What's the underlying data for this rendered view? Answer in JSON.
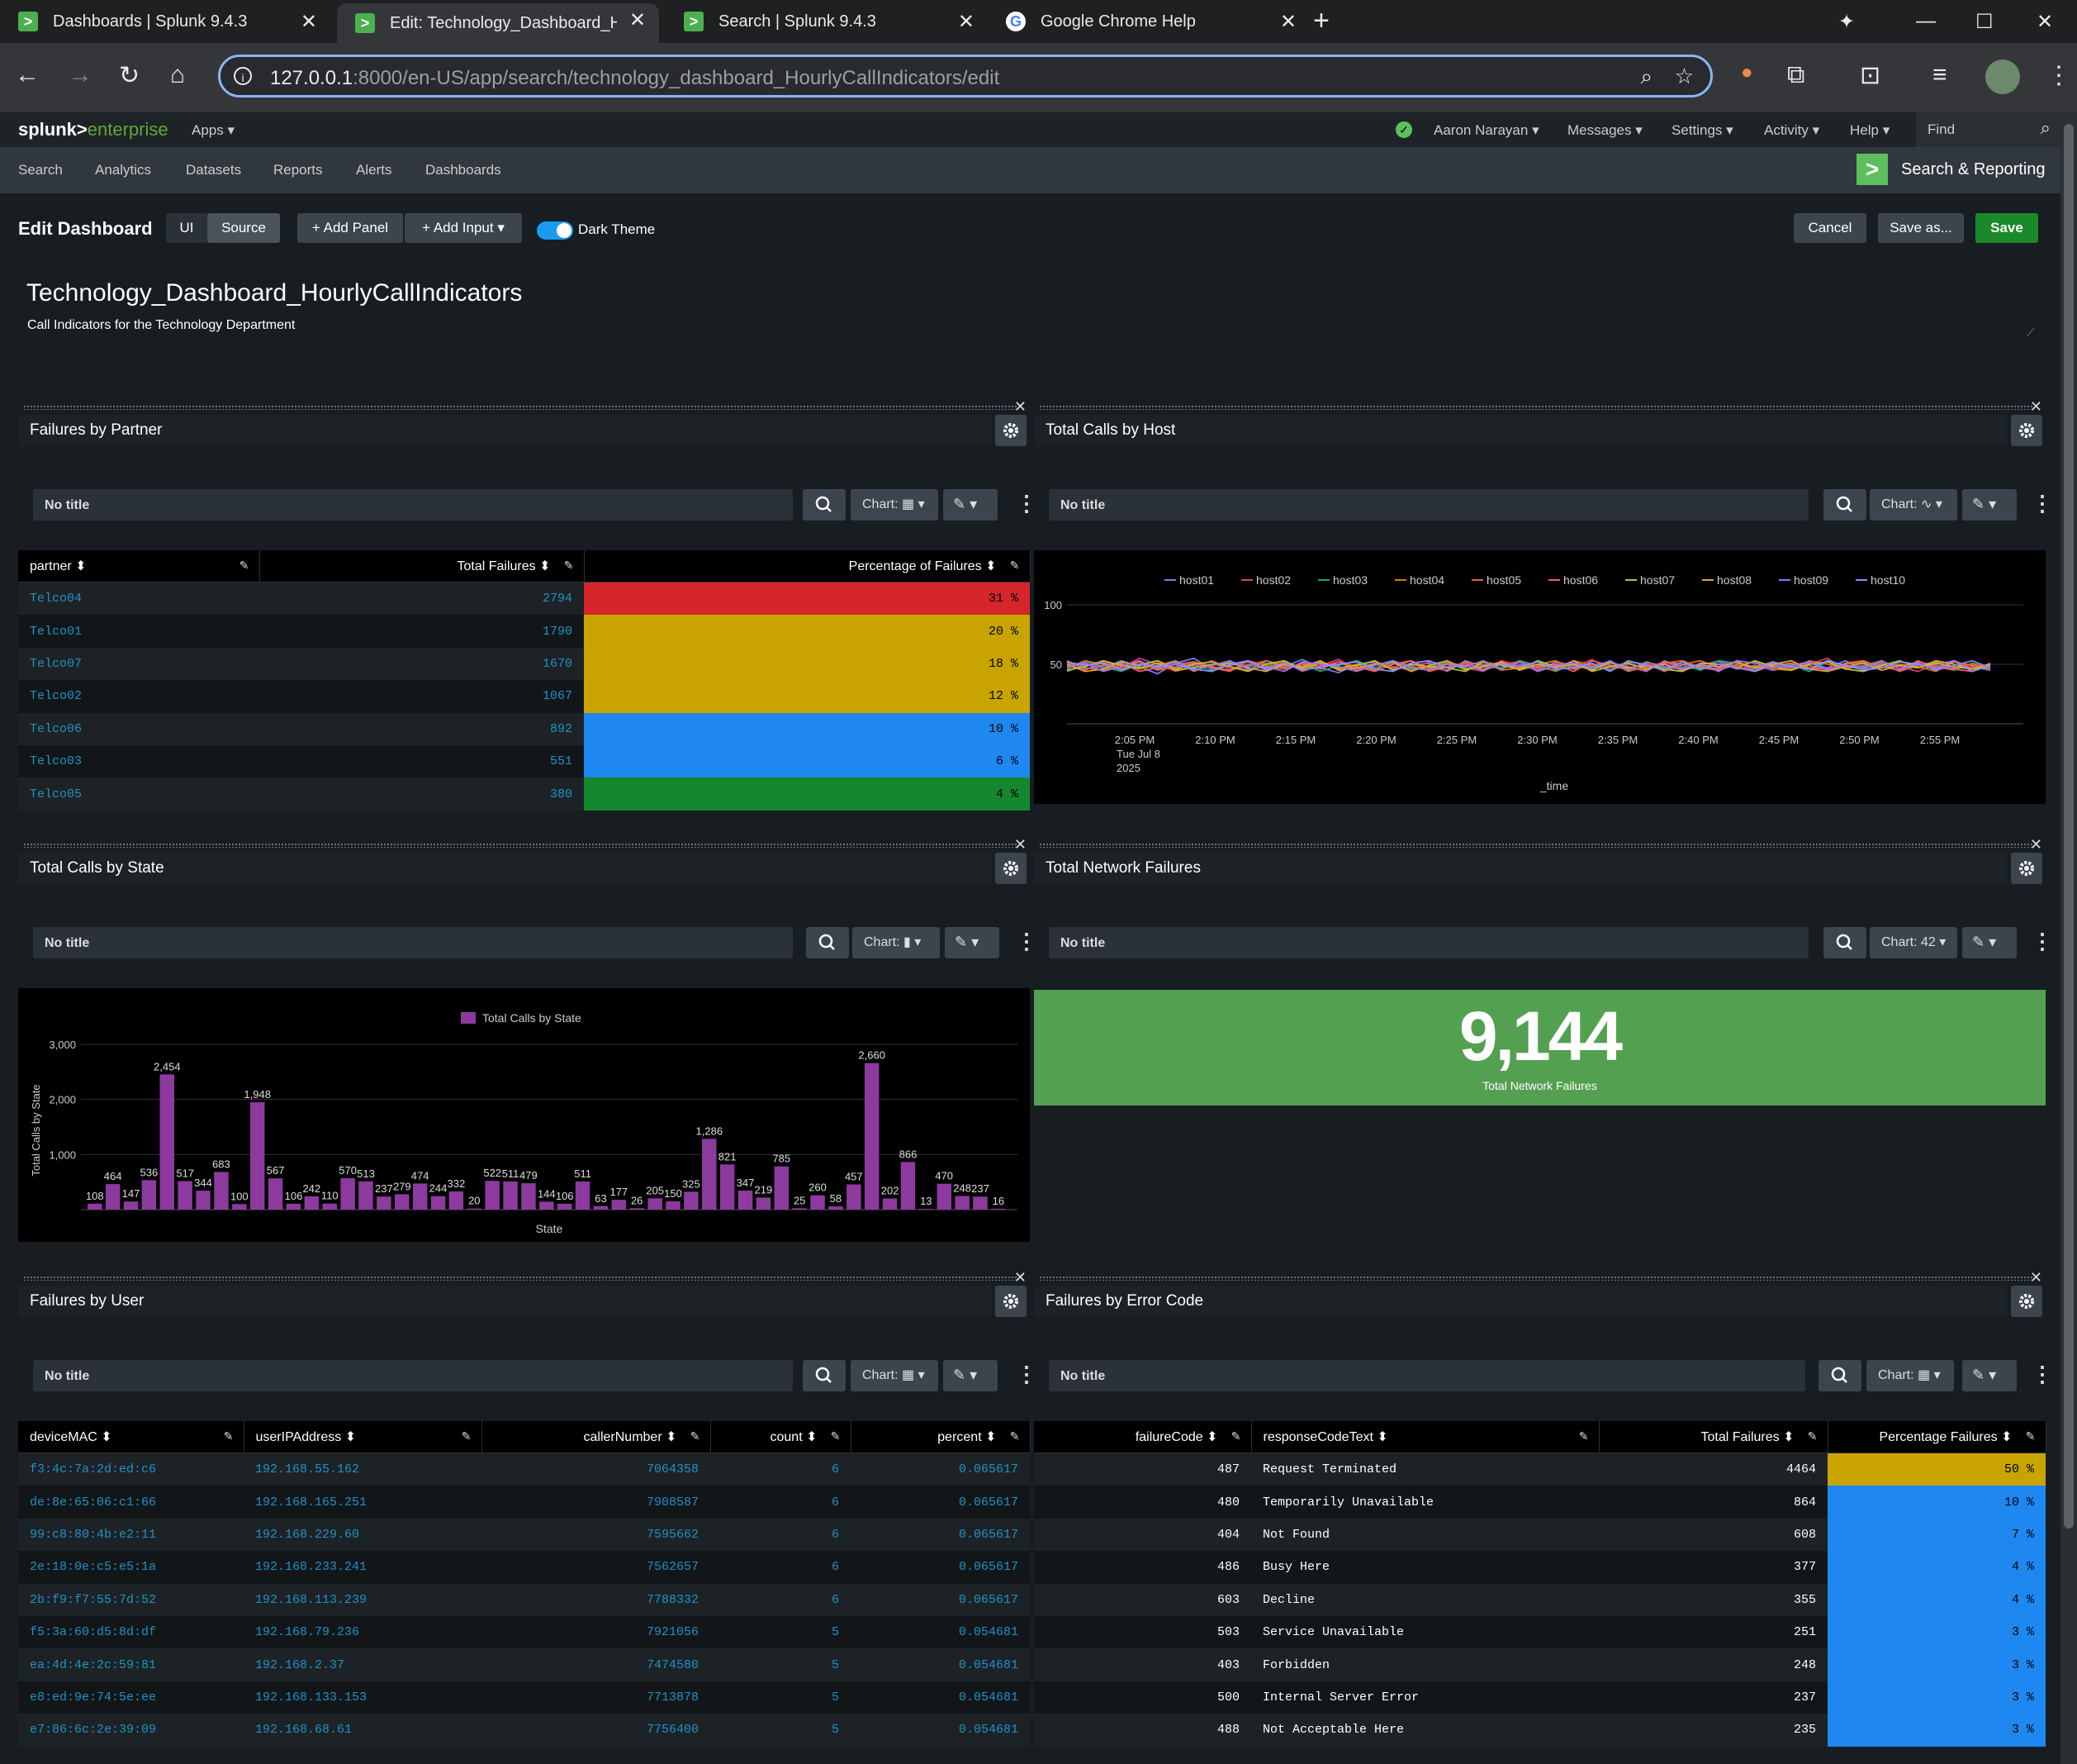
{
  "browser": {
    "tabs": [
      {
        "title": "Dashboards | Splunk 9.4.3",
        "active": false
      },
      {
        "title": "Edit: Technology_Dashboard_Hour",
        "active": true
      },
      {
        "title": "Search | Splunk 9.4.3",
        "active": false
      },
      {
        "title": "Google Chrome Help",
        "active": false
      }
    ],
    "url_host": "127.0.0.1",
    "url_path": ":8000/en-US/app/search/technology_dashboard_HourlyCallIndicators/edit"
  },
  "splunk": {
    "logo_main": "splunk>",
    "logo_sub": "enterprise",
    "apps": "Apps",
    "user": "Aaron Narayan",
    "menus": [
      "Messages",
      "Settings",
      "Activity",
      "Help"
    ],
    "find": "Find",
    "nav": [
      "Search",
      "Analytics",
      "Datasets",
      "Reports",
      "Alerts",
      "Dashboards"
    ],
    "app_name": "Search & Reporting"
  },
  "edit": {
    "title": "Edit Dashboard",
    "ui": "UI",
    "source": "Source",
    "add_panel": "+ Add Panel",
    "add_input": "+ Add Input",
    "dark_theme": "Dark Theme",
    "cancel": "Cancel",
    "save_as": "Save as...",
    "save": "Save"
  },
  "dashboard": {
    "title": "Technology_Dashboard_HourlyCallIndicators",
    "description": "Call Indicators for the Technology Department"
  },
  "common": {
    "no_title": "No title",
    "chart": "Chart:"
  },
  "panels": {
    "partner": {
      "title": "Failures by Partner",
      "columns": [
        "partner",
        "Total Failures",
        "Percentage of Failures"
      ],
      "rows": [
        {
          "partner": "Telco04",
          "total": "2794",
          "pct": "31 %",
          "color": "#d6262b"
        },
        {
          "partner": "Telco01",
          "total": "1790",
          "pct": "20 %",
          "color": "#c9a400"
        },
        {
          "partner": "Telco07",
          "total": "1670",
          "pct": "18 %",
          "color": "#c9a400"
        },
        {
          "partner": "Telco02",
          "total": "1067",
          "pct": "12 %",
          "color": "#c9a400"
        },
        {
          "partner": "Telco06",
          "total": "892",
          "pct": "10 %",
          "color": "#1e88f0"
        },
        {
          "partner": "Telco03",
          "total": "551",
          "pct": "6 %",
          "color": "#1e88f0"
        },
        {
          "partner": "Telco05",
          "total": "380",
          "pct": "4 %",
          "color": "#15882f"
        }
      ]
    },
    "host": {
      "title": "Total Calls by Host",
      "chart_label": "Chart:",
      "legend": [
        "host01",
        "host02",
        "host03",
        "host04",
        "host05",
        "host06",
        "host07",
        "host08",
        "host09",
        "host10"
      ],
      "colors": [
        "#7b7bf0",
        "#e0397a",
        "#17a57b",
        "#d47a16",
        "#f0602a",
        "#f25c7c",
        "#b6c52a",
        "#e0a63a",
        "#9e73f0",
        "#8a90f5"
      ],
      "y_ticks": [
        "100",
        "50"
      ],
      "x_ticks": [
        "2:05 PM",
        "2:10 PM",
        "2:15 PM",
        "2:20 PM",
        "2:25 PM",
        "2:30 PM",
        "2:35 PM",
        "2:40 PM",
        "2:45 PM",
        "2:50 PM",
        "2:55 PM"
      ],
      "x_sub": [
        "Tue Jul 8",
        "2025"
      ],
      "xlabel": "_time"
    },
    "state": {
      "title": "Total Calls by State",
      "chart_label": "Chart:",
      "legend": "Total Calls by State",
      "ylabel": "Total Calls by State",
      "xlabel": "State",
      "y_ticks": [
        "3,000",
        "2,000",
        "1,000"
      ],
      "color": "#8c3a9e"
    },
    "network": {
      "title": "Total Network Failures",
      "chart_label": "Chart: 42",
      "value": "9,144",
      "label": "Total Network Failures",
      "color": "#53a051"
    },
    "user": {
      "title": "Failures by User",
      "columns": [
        "deviceMAC",
        "userIPAddress",
        "callerNumber",
        "count",
        "percent"
      ],
      "rows": [
        [
          "f3:4c:7a:2d:ed:c6",
          "192.168.55.162",
          "7064358",
          "6",
          "0.065617"
        ],
        [
          "de:8e:65:06:c1:66",
          "192.168.165.251",
          "7908587",
          "6",
          "0.065617"
        ],
        [
          "99:c8:80:4b:e2:11",
          "192.168.229.60",
          "7595662",
          "6",
          "0.065617"
        ],
        [
          "2e:18:0e:c5:e5:1a",
          "192.168.233.241",
          "7562657",
          "6",
          "0.065617"
        ],
        [
          "2b:f9:f7:55:7d:52",
          "192.168.113.239",
          "7788332",
          "6",
          "0.065617"
        ],
        [
          "f5:3a:60:d5:8d:df",
          "192.168.79.236",
          "7921056",
          "5",
          "0.054681"
        ],
        [
          "ea:4d:4e:2c:59:81",
          "192.168.2.37",
          "7474580",
          "5",
          "0.054681"
        ],
        [
          "e8:ed:9e:74:5e:ee",
          "192.168.133.153",
          "7713878",
          "5",
          "0.054681"
        ],
        [
          "e7:86:6c:2e:39:09",
          "192.168.68.61",
          "7756400",
          "5",
          "0.054681"
        ]
      ]
    },
    "error": {
      "title": "Failures by Error Code",
      "columns": [
        "failureCode",
        "responseCodeText",
        "Total Failures",
        "Percentage Failures"
      ],
      "rows": [
        {
          "code": "487",
          "text": "Request Terminated",
          "total": "4464",
          "pct": "50 %",
          "color": "#c9a400"
        },
        {
          "code": "480",
          "text": "Temporarily Unavailable",
          "total": "864",
          "pct": "10 %",
          "color": "#1e88f0"
        },
        {
          "code": "404",
          "text": "Not Found",
          "total": "608",
          "pct": "7 %",
          "color": "#1e88f0"
        },
        {
          "code": "486",
          "text": "Busy Here",
          "total": "377",
          "pct": "4 %",
          "color": "#1e88f0"
        },
        {
          "code": "603",
          "text": "Decline",
          "total": "355",
          "pct": "4 %",
          "color": "#1e88f0"
        },
        {
          "code": "503",
          "text": "Service Unavailable",
          "total": "251",
          "pct": "3 %",
          "color": "#1e88f0"
        },
        {
          "code": "403",
          "text": "Forbidden",
          "total": "248",
          "pct": "3 %",
          "color": "#1e88f0"
        },
        {
          "code": "500",
          "text": "Internal Server Error",
          "total": "237",
          "pct": "3 %",
          "color": "#1e88f0"
        },
        {
          "code": "488",
          "text": "Not Acceptable Here",
          "total": "235",
          "pct": "3 %",
          "color": "#1e88f0"
        }
      ]
    }
  },
  "chart_data": [
    {
      "type": "line",
      "title": "",
      "xlabel": "_time",
      "ylabel": "",
      "ylim": [
        0,
        100
      ],
      "grid": true,
      "legend": "top",
      "series_names": [
        "host01",
        "host02",
        "host03",
        "host04",
        "host05",
        "host06",
        "host07",
        "host08",
        "host09",
        "host10"
      ],
      "series": [
        {
          "name": "host01",
          "values": [
            44,
            50,
            47,
            53,
            48,
            42,
            51,
            55,
            46,
            49,
            52,
            45,
            48,
            54,
            47,
            43,
            50,
            52,
            46,
            49,
            51,
            44,
            53,
            48,
            47,
            50,
            45,
            52,
            49,
            46,
            51,
            48,
            44,
            53,
            47,
            50,
            52,
            46,
            49,
            45,
            48,
            51,
            47,
            53,
            46,
            50,
            44,
            49,
            52,
            47,
            48,
            45
          ]
        },
        {
          "name": "host02",
          "values": [
            49,
            45,
            52,
            47,
            55,
            50,
            44,
            48,
            53,
            46,
            50,
            47,
            52,
            44,
            49,
            54,
            46,
            51,
            48,
            45,
            52,
            50,
            47,
            44,
            53,
            49,
            46,
            51,
            48,
            54,
            45,
            50,
            47,
            52,
            46,
            49,
            53,
            48,
            45,
            51,
            47,
            50,
            55,
            46,
            49,
            52,
            48,
            44,
            50,
            53,
            47,
            49
          ]
        },
        {
          "name": "host03",
          "values": [
            46,
            52,
            48,
            44,
            50,
            53,
            47,
            49,
            45,
            52,
            48,
            51,
            46,
            50,
            44,
            49,
            53,
            47,
            51,
            46,
            48,
            52,
            45,
            50,
            47,
            53,
            49,
            44,
            51,
            48,
            46,
            52,
            50,
            47,
            49,
            45,
            53,
            51,
            46,
            48,
            50,
            44,
            52,
            47,
            49,
            53,
            46,
            50,
            48,
            45,
            51,
            47
          ]
        },
        {
          "name": "host04",
          "values": [
            51,
            47,
            45,
            50,
            46,
            49,
            53,
            44,
            50,
            48,
            45,
            53,
            49,
            47,
            52,
            46,
            50,
            45,
            53,
            48,
            46,
            51,
            49,
            52,
            45,
            47,
            50,
            53,
            46,
            49,
            52,
            44,
            48,
            51,
            53,
            47,
            45,
            50,
            48,
            52,
            46,
            49,
            45,
            51,
            53,
            47,
            50,
            48,
            44,
            52,
            49,
            46
          ]
        },
        {
          "name": "host05",
          "values": [
            47,
            53,
            50,
            46,
            52,
            45,
            48,
            51,
            47,
            44,
            53,
            49,
            46,
            51,
            48,
            52,
            45,
            50,
            47,
            53,
            44,
            48,
            51,
            46,
            50,
            52,
            47,
            45,
            53,
            49,
            48,
            46,
            51,
            44,
            50,
            53,
            47,
            49,
            52,
            46,
            45,
            53,
            50,
            47,
            48,
            51,
            44,
            52,
            49,
            47,
            50,
            48
          ]
        },
        {
          "name": "host06",
          "values": [
            53,
            46,
            49,
            51,
            44,
            47,
            50,
            52,
            48,
            45,
            49,
            53,
            47,
            50,
            46,
            52,
            48,
            44,
            50,
            53,
            47,
            45,
            52,
            49,
            51,
            46,
            48,
            50,
            44,
            53,
            49,
            47,
            45,
            52,
            50,
            48,
            46,
            53,
            44,
            49,
            51,
            47,
            46,
            50,
            52,
            48,
            45,
            53,
            47,
            46,
            44,
            51
          ]
        },
        {
          "name": "host07",
          "values": [
            45,
            48,
            53,
            49,
            47,
            51,
            46,
            50,
            52,
            48,
            44,
            50,
            53,
            46,
            51,
            47,
            49,
            53,
            45,
            50,
            48,
            47,
            44,
            52,
            49,
            46,
            53,
            48,
            50,
            45,
            52,
            47,
            49,
            46,
            44,
            51,
            50,
            47,
            53,
            48,
            45,
            50,
            52,
            46,
            44,
            49,
            53,
            47,
            51,
            48,
            46,
            50
          ]
        },
        {
          "name": "host08",
          "values": [
            50,
            44,
            46,
            52,
            49,
            53,
            45,
            47,
            50,
            51,
            47,
            44,
            50,
            48,
            53,
            45,
            47,
            50,
            52,
            44,
            49,
            53,
            46,
            48,
            52,
            45,
            50,
            47,
            53,
            44,
            48,
            51,
            46,
            50,
            45,
            49,
            48,
            52,
            47,
            50,
            53,
            46,
            44,
            48,
            51,
            45,
            49,
            47,
            53,
            50,
            46,
            48
          ]
        },
        {
          "name": "host09",
          "values": [
            48,
            51,
            44,
            48,
            53,
            46,
            50,
            45,
            49,
            53,
            46,
            48,
            44,
            52,
            50,
            48,
            44,
            49,
            53,
            47,
            45,
            50,
            48,
            53,
            46,
            52,
            44,
            49,
            51,
            47,
            53,
            45,
            52,
            48,
            46,
            50,
            44,
            53,
            51,
            47,
            49,
            52,
            45,
            49,
            47,
            53,
            46,
            51,
            45,
            49,
            53,
            47
          ]
        },
        {
          "name": "host10",
          "values": [
            52,
            49,
            51,
            45,
            50,
            48,
            52,
            46,
            44,
            50,
            53,
            46,
            51,
            45,
            48,
            50,
            52,
            46,
            44,
            51,
            53,
            47,
            49,
            45,
            50,
            48,
            52,
            46,
            47,
            51,
            44,
            53,
            49,
            45,
            52,
            46,
            50,
            47,
            44,
            52,
            48,
            46,
            53,
            49,
            45,
            47,
            52,
            50,
            46,
            53,
            44,
            49
          ]
        }
      ],
      "x": [
        "2:05 PM",
        "2:10 PM",
        "2:15 PM",
        "2:20 PM",
        "2:25 PM",
        "2:30 PM",
        "2:35 PM",
        "2:40 PM",
        "2:45 PM",
        "2:50 PM",
        "2:55 PM"
      ]
    },
    {
      "type": "bar",
      "title": "",
      "xlabel": "State",
      "ylabel": "Total Calls by State",
      "ylim": [
        0,
        3000
      ],
      "grid": true,
      "legend": "top",
      "series_names": [
        "Total Calls by State"
      ],
      "values": [
        108,
        464,
        147,
        536,
        2454,
        517,
        344,
        683,
        100,
        1948,
        567,
        106,
        242,
        110,
        570,
        513,
        237,
        279,
        474,
        244,
        332,
        20,
        522,
        511,
        479,
        144,
        106,
        511,
        63,
        177,
        26,
        205,
        150,
        325,
        1286,
        821,
        347,
        219,
        785,
        25,
        260,
        58,
        457,
        2660,
        202,
        866,
        13,
        470,
        248,
        237,
        16
      ],
      "labels": [
        "108",
        "464",
        "147",
        "536",
        "2,454",
        "517",
        "344",
        "683",
        "100",
        "1,948",
        "567",
        "106",
        "242",
        "110",
        "570",
        "513",
        "237",
        "279",
        "474",
        "244",
        "332",
        "20",
        "522",
        "511",
        "479",
        "144",
        "106",
        "511",
        "63",
        "177",
        "26",
        "205",
        "150",
        "325",
        "1,286",
        "821",
        "347",
        "219",
        "785",
        "25",
        "260",
        "58",
        "457",
        "2,660",
        "202",
        "866",
        "13",
        "470",
        "248",
        "237",
        "16"
      ]
    },
    {
      "type": "table",
      "title": "Total Network Failures",
      "value": 9144
    }
  ]
}
